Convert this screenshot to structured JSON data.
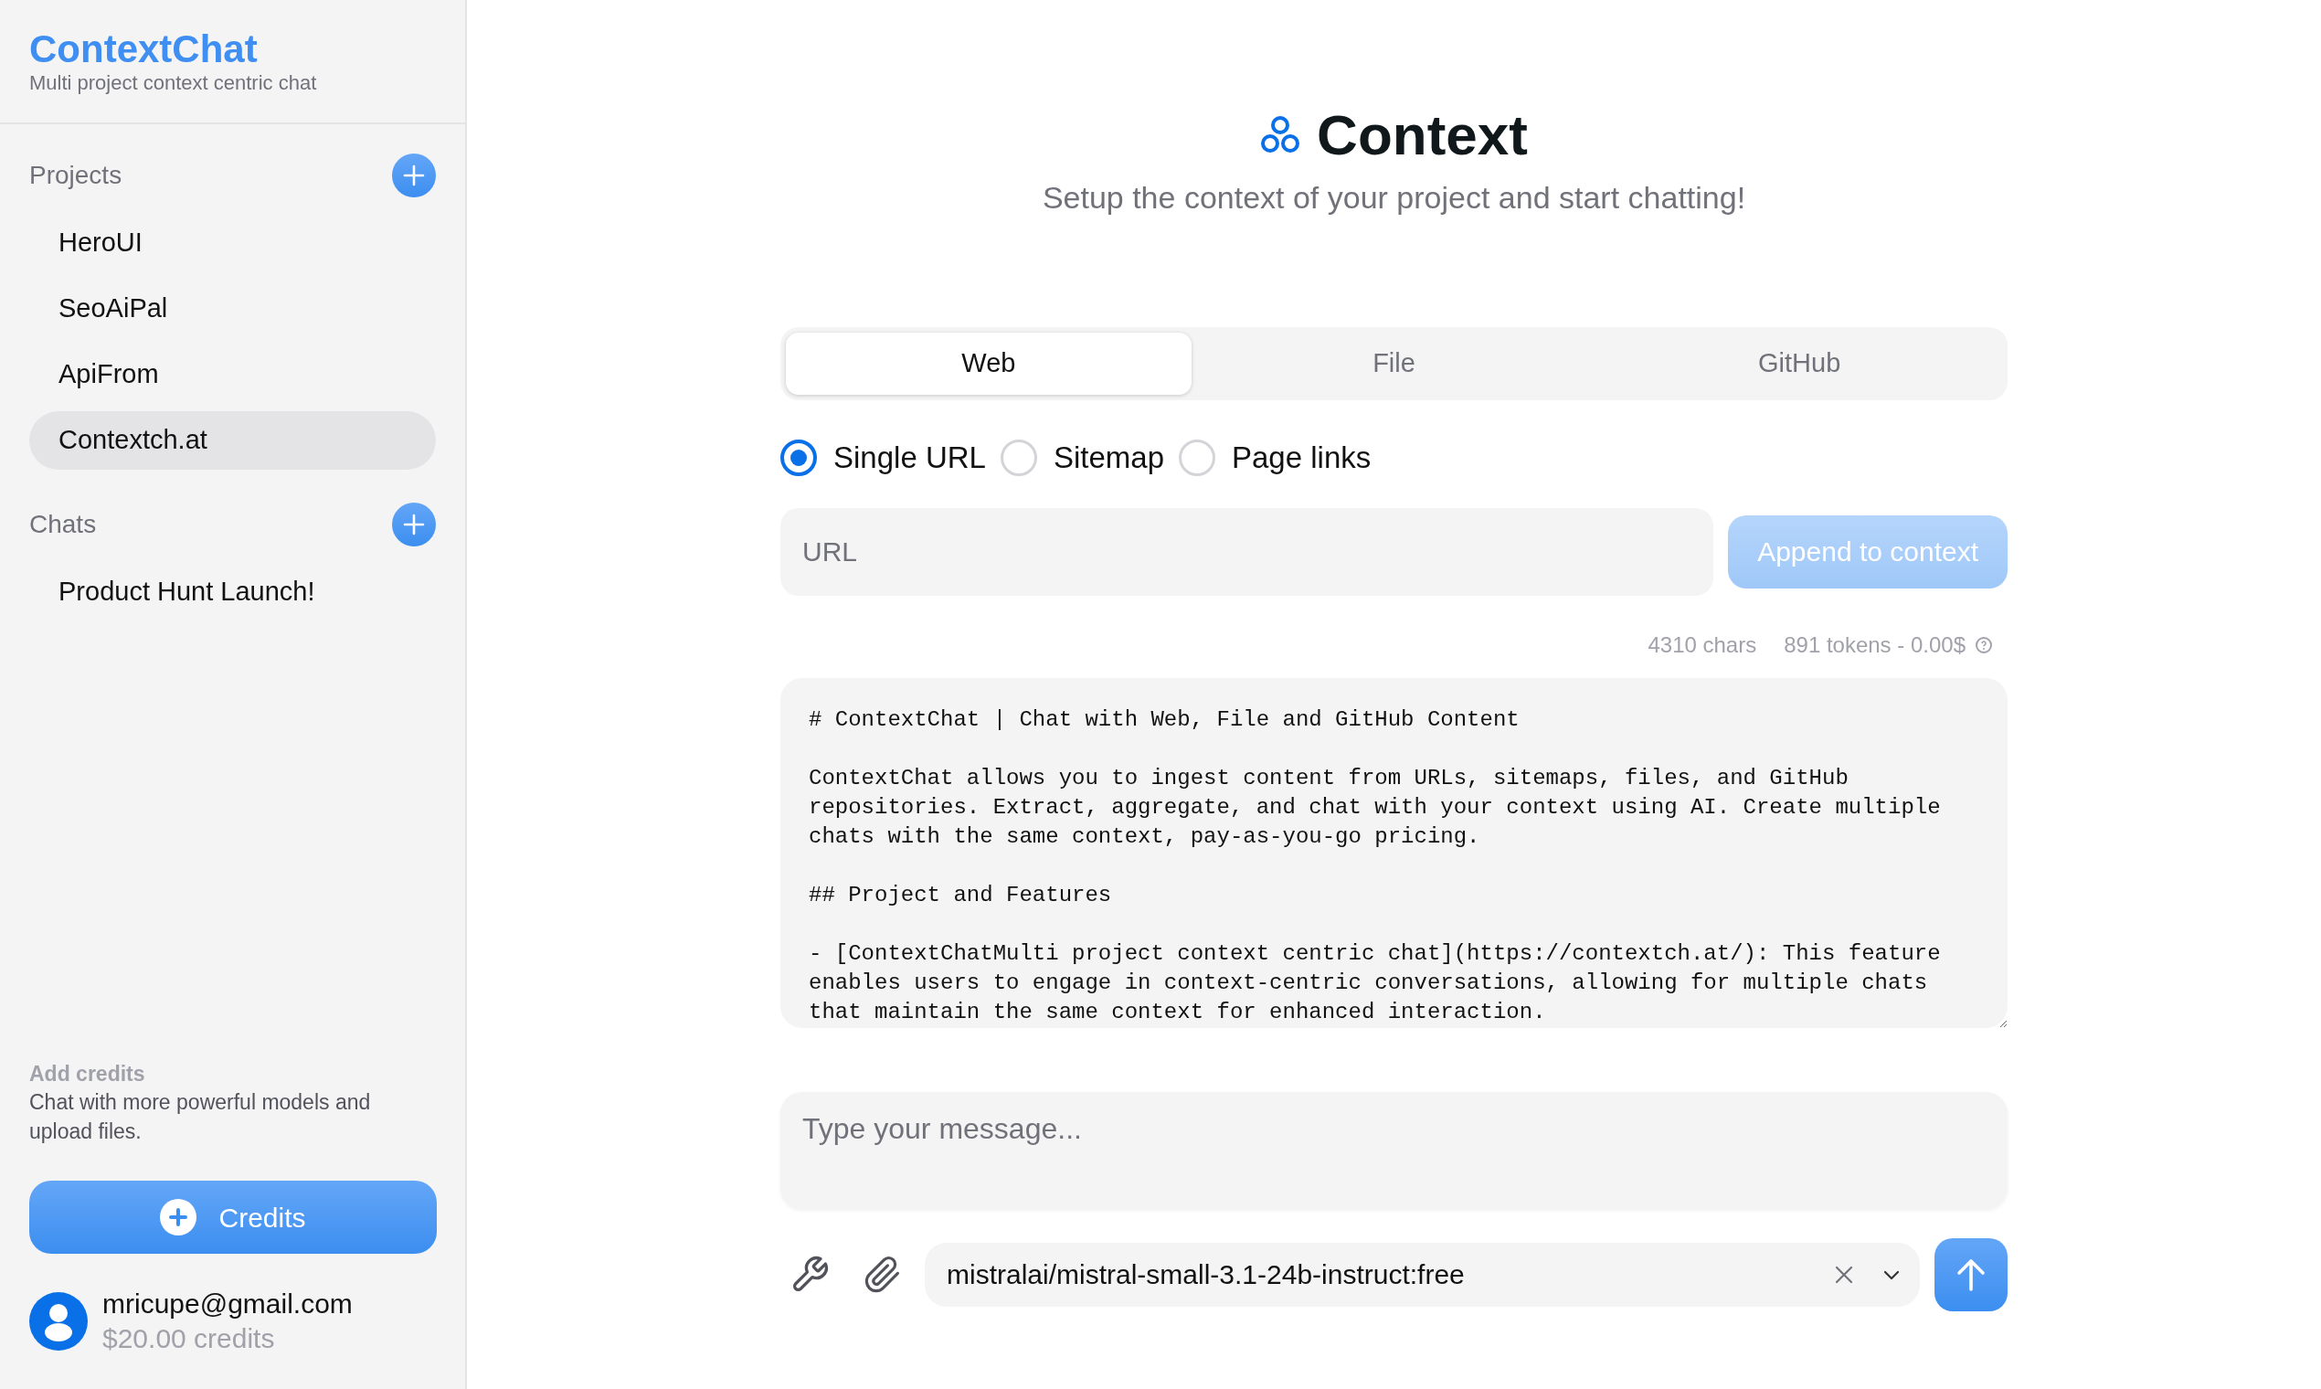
{
  "sidebar": {
    "logo": "ContextChat",
    "tagline": "Multi project context centric chat",
    "sections": [
      {
        "title": "Projects",
        "items": [
          {
            "label": "HeroUI",
            "selected": false
          },
          {
            "label": "SeoAiPal",
            "selected": false
          },
          {
            "label": "ApiFrom",
            "selected": false
          },
          {
            "label": "Contextch.at",
            "selected": true
          }
        ]
      },
      {
        "title": "Chats",
        "items": [
          {
            "label": "Product Hunt Launch!",
            "selected": false
          }
        ]
      }
    ],
    "promo": {
      "title": "Add credits",
      "text": "Chat with more powerful models and upload files."
    },
    "credits_button": "Credits",
    "user": {
      "email": "mricupe@gmail.com",
      "credits": "$20.00 credits"
    }
  },
  "main": {
    "title": "Context",
    "subtitle": "Setup the context of your project and start chatting!",
    "tabs": [
      {
        "label": "Web",
        "selected": true
      },
      {
        "label": "File",
        "selected": false
      },
      {
        "label": "GitHub",
        "selected": false
      }
    ],
    "source_options": [
      {
        "label": "Single URL",
        "selected": true
      },
      {
        "label": "Sitemap",
        "selected": false
      },
      {
        "label": "Page links",
        "selected": false
      }
    ],
    "url_field": {
      "placeholder": "URL"
    },
    "append_button": {
      "label": "Append to context",
      "disabled": true
    },
    "stats": {
      "chars": "4310 chars",
      "tokens": "891 tokens - 0.00$"
    },
    "context_text": "# ContextChat | Chat with Web, File and GitHub Content\n\nContextChat allows you to ingest content from URLs, sitemaps, files, and GitHub repositories. Extract, aggregate, and chat with your context using AI. Create multiple chats with the same context, pay-as-you-go pricing.\n\n## Project and Features\n\n- [ContextChatMulti project context centric chat](https://contextch.at/): This feature enables users to engage in context-centric conversations, allowing for multiple chats that maintain the same context for enhanced interaction.",
    "message_field": {
      "placeholder": "Type your message..."
    },
    "model": "mistralai/mistral-small-3.1-24b-instruct:free"
  }
}
